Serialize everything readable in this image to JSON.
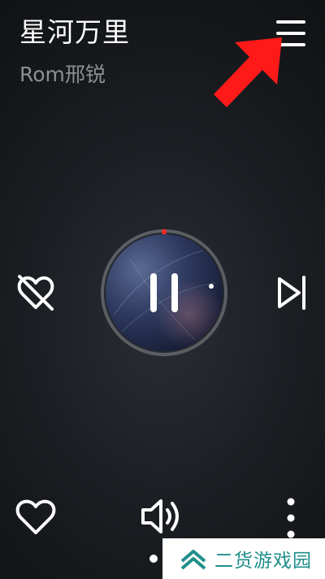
{
  "player": {
    "song_title": "星河万里",
    "artist": "Rom邢锐",
    "is_playing": true,
    "progress_fraction": 0.0
  },
  "icons": {
    "menu": "hamburger-menu-icon",
    "annotation_arrow": "red-arrow-icon",
    "dislike": "heart-crossed-icon",
    "pause": "pause-icon",
    "next": "skip-next-icon",
    "like": "heart-outline-icon",
    "volume": "volume-icon",
    "more": "more-vertical-icon"
  },
  "colors": {
    "accent_red": "#ff1a1a",
    "watermark_green": "#1f8f8a",
    "secondary_text": "#8c8f93"
  },
  "watermark": {
    "text": "二货游戏园"
  }
}
